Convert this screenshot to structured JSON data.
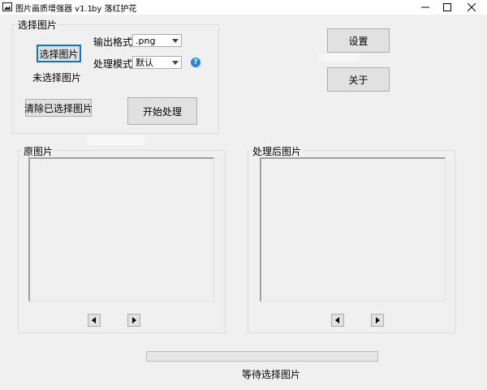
{
  "window": {
    "title": "图片画质增强器 v1.1",
    "author": "by 落红护花",
    "icon": "image-icon",
    "controls": [
      "minimize-icon",
      "maximize-icon",
      "close-icon"
    ]
  },
  "select_group": {
    "label": "选择图片",
    "select_button": "选择图片",
    "status": "未选择图片",
    "clear_button": "清除已选择图片",
    "start_button": "开始处理"
  },
  "output_format": {
    "label": "输出格式",
    "value": ".png"
  },
  "process_mode": {
    "label": "处理模式",
    "value": "默认"
  },
  "help": {
    "glyph": "?",
    "icon": "help-icon"
  },
  "side_buttons": {
    "settings": "设置",
    "about": "关于"
  },
  "original_panel": {
    "label": "原图片"
  },
  "processed_panel": {
    "label": "处理后图片"
  },
  "progress": {
    "value": 0,
    "status": "等待选择图片"
  },
  "colors": {
    "accent": "#0078d7",
    "help": "#1e88e5",
    "progress": "#06b025"
  }
}
